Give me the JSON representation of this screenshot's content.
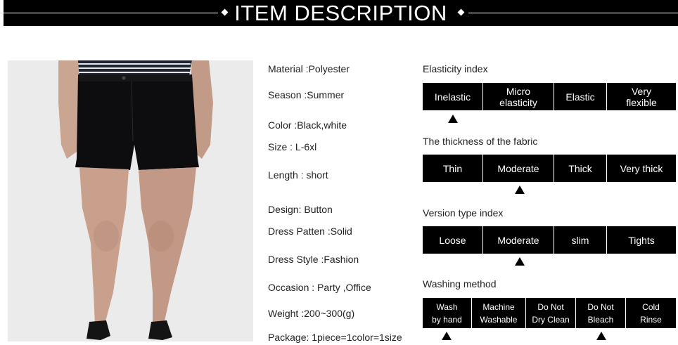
{
  "header": {
    "title": "ITEM DESCRIPTION"
  },
  "specs": [
    "Material :Polyester",
    "Season :Summer",
    "Color :Black,white",
    "Size : L-6xl",
    "Length : short",
    "Design: Button",
    "Dress Patten :Solid",
    "Dress Style :Fashion",
    "Occasion : Party ,Office",
    "Weight :200~300(g)",
    "Package: 1piece=1color=1size"
  ],
  "indexes": [
    {
      "title": "Elasticity index",
      "options": [
        "Inelastic",
        "Micro\nelasticity",
        "Elastic",
        "Very\nflexible"
      ],
      "selected": 0
    },
    {
      "title": "The thickness of the fabric",
      "options": [
        "Thin",
        "Moderate",
        "Thick",
        "Very thick"
      ],
      "selected": 1
    },
    {
      "title": "Version type index",
      "options": [
        "Loose",
        "Moderate",
        "slim",
        "Tights"
      ],
      "selected": 1
    },
    {
      "title": "Washing method",
      "options": [
        "Wash\nby hand",
        "Machine\nWashable",
        "Do Not\nDry Clean",
        "Do Not\nBleach",
        "Cold\nRinse"
      ],
      "selected": [
        0,
        3
      ]
    }
  ],
  "colors": {
    "bar": "#000000",
    "header": "#000000",
    "text": "#222222"
  }
}
